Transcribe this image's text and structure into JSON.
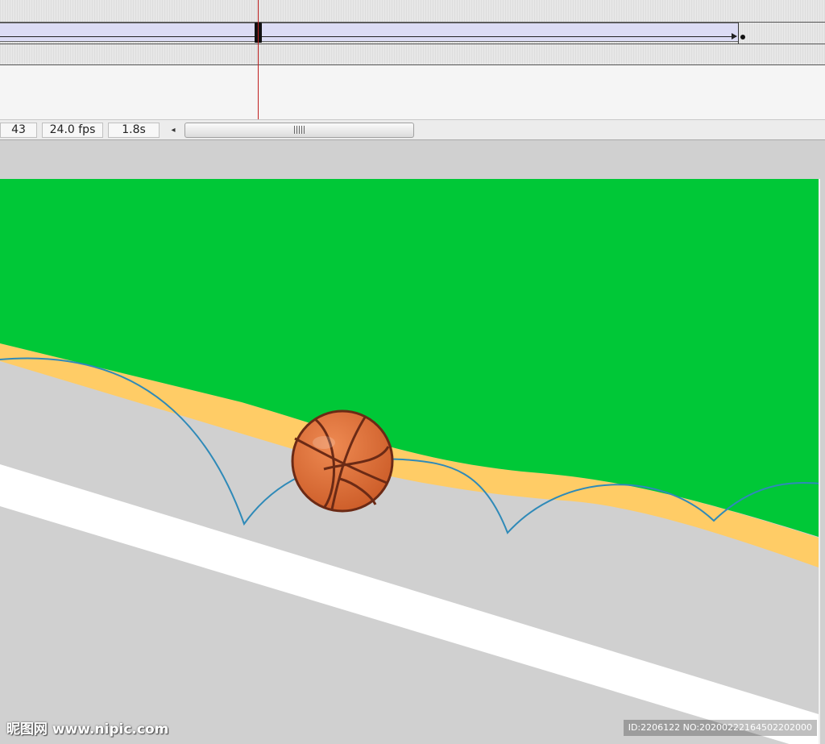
{
  "timeline": {
    "current_frame": "43",
    "frame_rate": "24.0 fps",
    "elapsed_time": "1.8s",
    "scroll_left_icon": "◂",
    "tween_fill_color": "#dcdcf4",
    "playhead_color": "#c02020"
  },
  "stage": {
    "background_color": "#00c837",
    "shore_color": "#ffcc66",
    "ground_color": "#d0d0d0",
    "stripe_color": "#ffffff",
    "motion_path_color": "#2f8ab8",
    "ball_color": "#e07038",
    "ball_seam_color": "#6b2a15"
  },
  "watermark": {
    "site": "昵图网 www.nipic.com",
    "id_text": "ID:2206122 NO:20200222164502202000"
  }
}
